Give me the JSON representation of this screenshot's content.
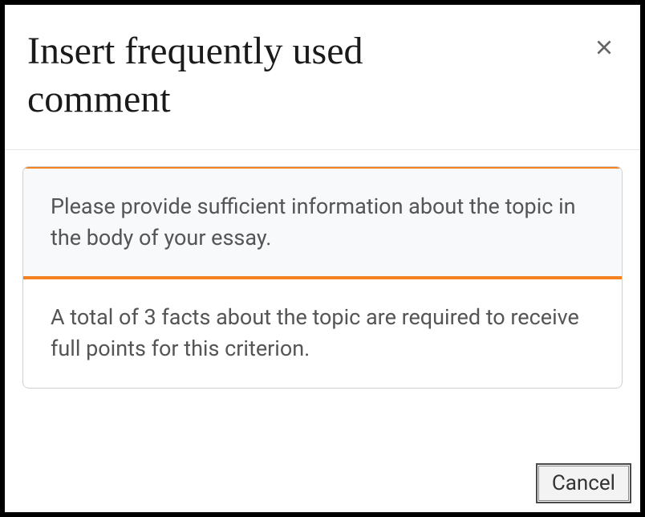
{
  "dialog": {
    "title": "Insert frequently used comment",
    "close_label": "Close"
  },
  "comments": [
    {
      "text": "Please provide sufficient information about the topic in the body of your essay.",
      "selected": true
    },
    {
      "text": "A total of 3 facts about the topic are required to receive full points for this criterion.",
      "selected": false
    }
  ],
  "footer": {
    "cancel_label": "Cancel"
  }
}
